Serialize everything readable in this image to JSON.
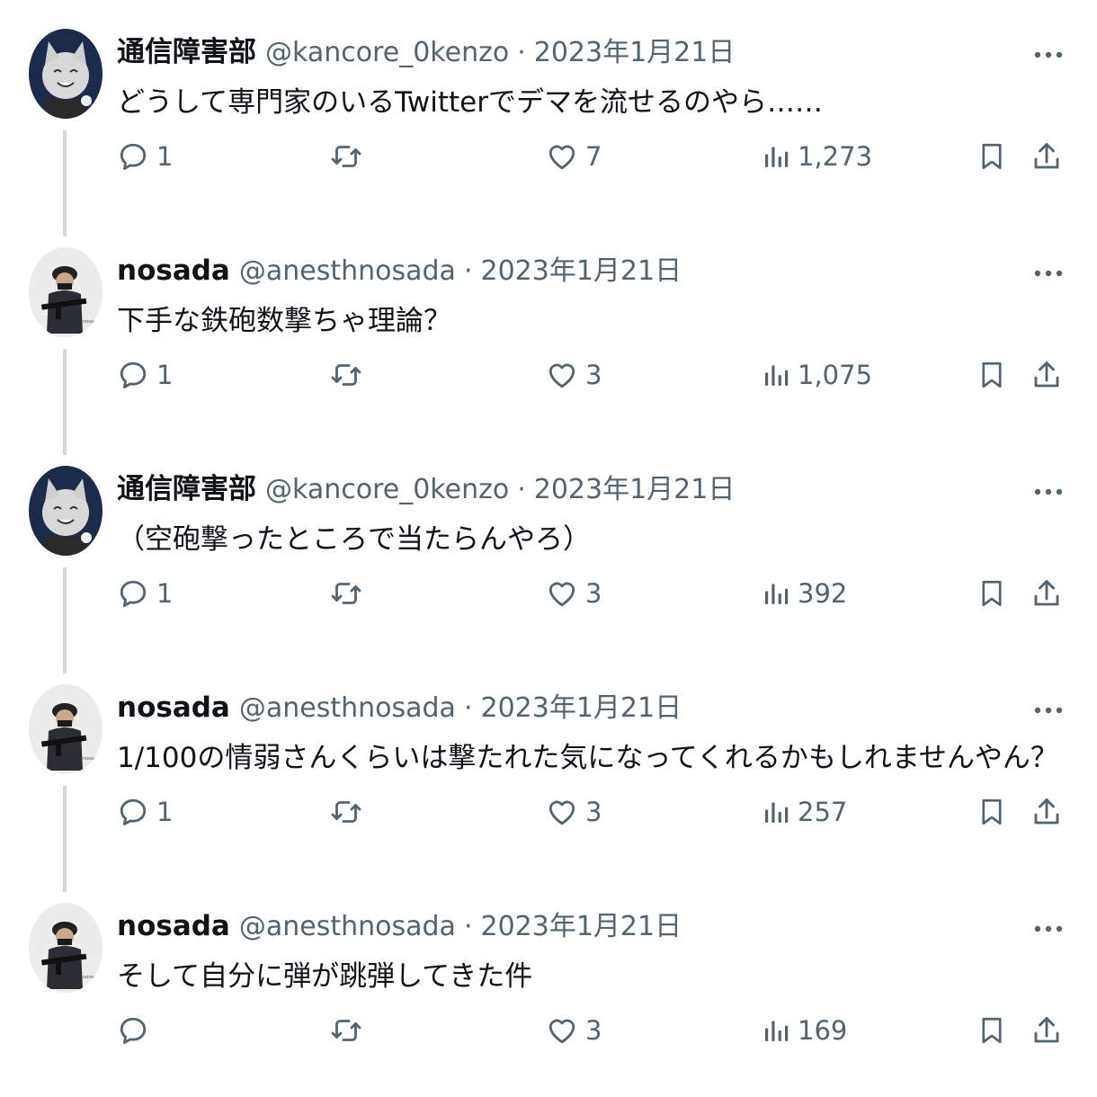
{
  "tweets": [
    {
      "author": "通信障害部",
      "handle": "@kancore_0kenzo",
      "separator": "·",
      "date": "2023年1月21日",
      "text": "どうして専門家のいるTwitterでデマを流せるのやら……",
      "replies": "1",
      "retweets": "",
      "likes": "7",
      "views": "1,273",
      "avatar_icon": "cat-avatar-icon"
    },
    {
      "author": "nosada",
      "handle": "@anesthnosada",
      "separator": "·",
      "date": "2023年1月21日",
      "text": "下手な鉄砲数撃ちゃ理論？",
      "replies": "1",
      "retweets": "",
      "likes": "3",
      "views": "1,075",
      "avatar_icon": "soldier-avatar-icon"
    },
    {
      "author": "通信障害部",
      "handle": "@kancore_0kenzo",
      "separator": "·",
      "date": "2023年1月21日",
      "text": "（空砲撃ったところで当たらんやろ）",
      "replies": "1",
      "retweets": "",
      "likes": "3",
      "views": "392",
      "avatar_icon": "cat-avatar-icon"
    },
    {
      "author": "nosada",
      "handle": "@anesthnosada",
      "separator": "·",
      "date": "2023年1月21日",
      "text": "1/100の情弱さんくらいは撃たれた気になってくれるかもしれませんやん？",
      "replies": "1",
      "retweets": "",
      "likes": "3",
      "views": "257",
      "avatar_icon": "soldier-avatar-icon"
    },
    {
      "author": "nosada",
      "handle": "@anesthnosada",
      "separator": "·",
      "date": "2023年1月21日",
      "text": "そして自分に弾が跳弾してきた件",
      "replies": "",
      "retweets": "",
      "likes": "3",
      "views": "169",
      "avatar_icon": "soldier-avatar-icon"
    }
  ],
  "colors": {
    "text_primary": "#0f1419",
    "text_secondary": "#536471",
    "thread_line": "#cfd9de"
  }
}
